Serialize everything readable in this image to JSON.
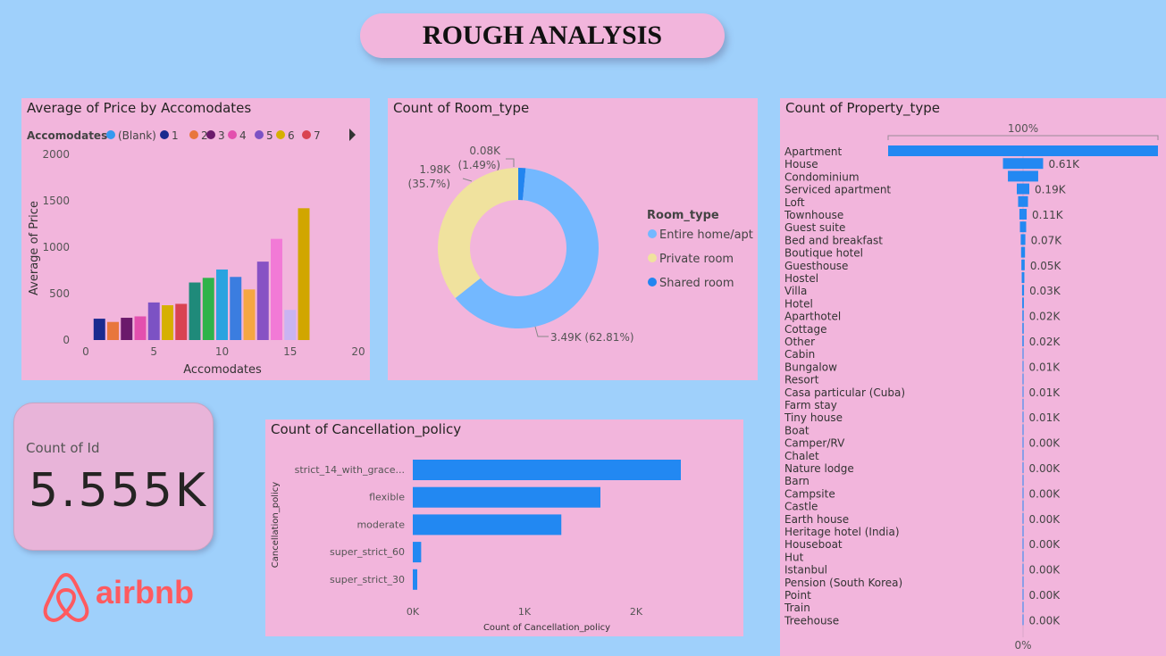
{
  "header": {
    "title": "ROUGH ANALYSIS"
  },
  "kpi": {
    "label": "Count of Id",
    "value": "5.555K"
  },
  "logo": {
    "text": "airbnb",
    "color": "#ff5a5f"
  },
  "chart_data": [
    {
      "id": "price",
      "type": "bar",
      "title": "Average of Price by Accomodates",
      "xlabel": "Accomodates",
      "ylabel": "Average of Price",
      "legend_title": "Accomodates",
      "legend": [
        {
          "label": "(Blank)",
          "color": "#3599f0"
        },
        {
          "label": "1",
          "color": "#1a2a8f"
        },
        {
          "label": "2",
          "color": "#e8763c"
        },
        {
          "label": "3",
          "color": "#6b1a6b"
        },
        {
          "label": "4",
          "color": "#e34fae"
        },
        {
          "label": "5",
          "color": "#7c52c4"
        },
        {
          "label": "6",
          "color": "#d6b000"
        },
        {
          "label": "7",
          "color": "#d94352"
        }
      ],
      "x": [
        1,
        2,
        3,
        4,
        5,
        6,
        7,
        8,
        9,
        10,
        11,
        12,
        13,
        14,
        15,
        16
      ],
      "values": [
        230,
        195,
        240,
        255,
        405,
        375,
        390,
        620,
        670,
        760,
        680,
        545,
        845,
        1090,
        325,
        1420
      ],
      "colors": [
        "#1a2a8f",
        "#e8763c",
        "#6b1a6b",
        "#e34fae",
        "#7c52c4",
        "#d6b000",
        "#d94352",
        "#1f8a7a",
        "#2fb34a",
        "#2aa3e0",
        "#3b7de0",
        "#f5a742",
        "#8752c4",
        "#f27ad6",
        "#c9b4f2",
        "#d1a600"
      ],
      "xlim": [
        0,
        20
      ],
      "ylim": [
        0,
        2000
      ],
      "xticks": [
        "0",
        "5",
        "10",
        "15",
        "20"
      ],
      "yticks": [
        "0",
        "500",
        "1000",
        "1500",
        "2000"
      ]
    },
    {
      "id": "room",
      "type": "pie",
      "title": "Count of Room_type",
      "legend_title": "Room_type",
      "slices": [
        {
          "label": "Entire home/apt",
          "value": 3490,
          "percent": 62.81,
          "display": "3.49K (62.81%)",
          "color": "#73b8ff"
        },
        {
          "label": "Private room",
          "value": 1980,
          "percent": 35.7,
          "display": "1.98K (35.7%)",
          "color": "#f0e29e"
        },
        {
          "label": "Shared room",
          "value": 80,
          "percent": 1.49,
          "display": "0.08K (1.49%)",
          "color": "#2285f0"
        }
      ],
      "slice_labels": {
        "entire": "3.49K (62.81%)",
        "private_value": "1.98K",
        "private_pct": "(35.7%)",
        "shared_value": "0.08K",
        "shared_pct": "(1.49%)"
      }
    },
    {
      "id": "cancel",
      "type": "bar",
      "orientation": "horizontal",
      "title": "Count of Cancellation_policy",
      "xlabel": "Count of Cancellation_policy",
      "ylabel": "Cancellation_policy",
      "categories": [
        "strict_14_with_grace...",
        "flexible",
        "moderate",
        "super_strict_60",
        "super_strict_30"
      ],
      "values": [
        2400,
        1680,
        1330,
        75,
        40
      ],
      "xlim": [
        0,
        2400
      ],
      "xticks": [
        "0K",
        "1K",
        "2K"
      ],
      "color": "#2288f2"
    },
    {
      "id": "property",
      "type": "bar",
      "orientation": "funnel",
      "title": "Count of Property_type",
      "top_label": "100%",
      "bottom_label": "0%",
      "color": "#2288f2",
      "categories": [
        "Apartment",
        "House",
        "Condominium",
        "Serviced apartment",
        "Loft",
        "Townhouse",
        "Guest suite",
        "Bed and breakfast",
        "Boutique hotel",
        "Guesthouse",
        "Hostel",
        "Villa",
        "Hotel",
        "Aparthotel",
        "Cottage",
        "Other",
        "Cabin",
        "Bungalow",
        "Resort",
        "Casa particular (Cuba)",
        "Farm stay",
        "Tiny house",
        "Boat",
        "Camper/RV",
        "Chalet",
        "Nature lodge",
        "Barn",
        "Campsite",
        "Castle",
        "Earth house",
        "Heritage hotel (India)",
        "Houseboat",
        "Hut",
        "Istanbul",
        "Pension (South Korea)",
        "Point",
        "Train",
        "Treehouse"
      ],
      "values": [
        4100,
        610,
        460,
        190,
        150,
        110,
        95,
        70,
        60,
        50,
        40,
        30,
        25,
        20,
        20,
        20,
        12,
        10,
        10,
        10,
        8,
        8,
        4,
        4,
        3,
        3,
        2,
        2,
        2,
        2,
        1,
        1,
        1,
        1,
        1,
        1,
        1,
        1
      ],
      "data_labels": [
        "",
        "0.61K",
        "",
        "0.19K",
        "",
        "0.11K",
        "",
        "0.07K",
        "",
        "0.05K",
        "",
        "0.03K",
        "",
        "0.02K",
        "",
        "0.02K",
        "",
        "0.01K",
        "",
        "0.01K",
        "",
        "0.01K",
        "",
        "0.00K",
        "",
        "0.00K",
        "",
        "0.00K",
        "",
        "0.00K",
        "",
        "0.00K",
        "",
        "0.00K",
        "",
        "0.00K",
        "",
        "0.00K"
      ]
    }
  ]
}
